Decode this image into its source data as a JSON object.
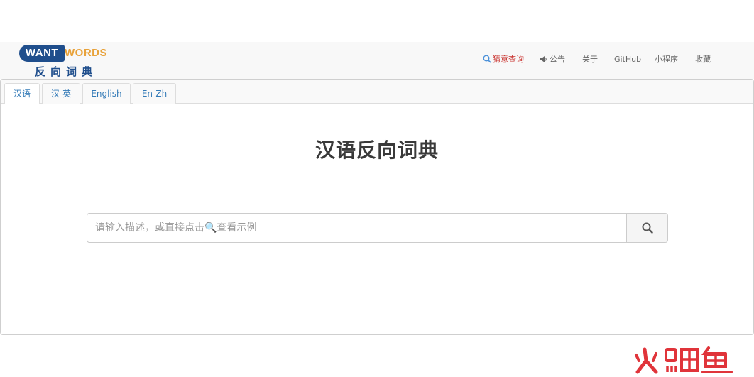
{
  "logo": {
    "brand_left": "WANT",
    "brand_right": "WORDS",
    "subtitle": "反向词典",
    "colors": {
      "navy": "#1f4e8c",
      "orange": "#e8a23a"
    }
  },
  "nav": {
    "items": [
      {
        "label": "猜意查询",
        "icon": "search-icon",
        "active": true
      },
      {
        "label": "公告",
        "icon": "megaphone-icon",
        "active": false
      },
      {
        "label": "关于",
        "icon": "",
        "active": false
      },
      {
        "label": "GitHub",
        "icon": "",
        "active": false
      },
      {
        "label": "小程序",
        "icon": "",
        "active": false
      },
      {
        "label": "收藏",
        "icon": "",
        "active": false
      }
    ],
    "colors": {
      "active": "#c9302c",
      "normal": "#666666"
    }
  },
  "tabs": [
    {
      "label": "汉语",
      "active": true
    },
    {
      "label": "汉-英",
      "active": false
    },
    {
      "label": "English",
      "active": false
    },
    {
      "label": "En-Zh",
      "active": false
    }
  ],
  "main": {
    "title": "汉语反向词典",
    "search": {
      "value": "",
      "placeholder": "请输入描述，或直接点击🔍查看示例"
    }
  },
  "watermark": {
    "text": "火鲤鱼",
    "color": "#e0343a"
  }
}
